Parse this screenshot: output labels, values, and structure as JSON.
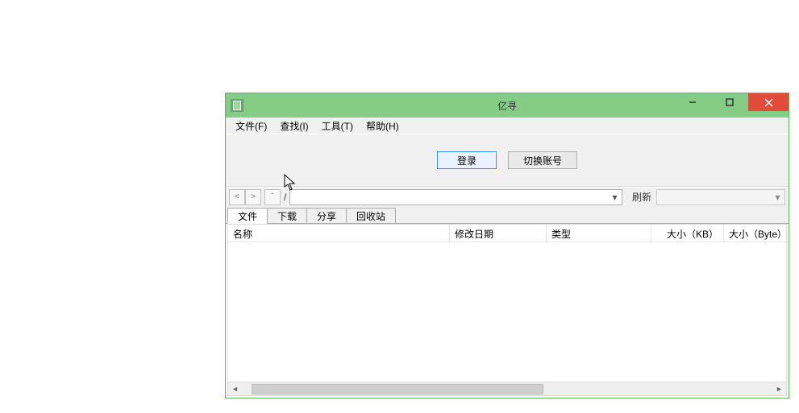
{
  "window": {
    "title": "亿寻"
  },
  "menu": {
    "file": "文件(F)",
    "find": "查找(I)",
    "tools": "工具(T)",
    "help": "帮助(H)"
  },
  "toolbar": {
    "login": "登录",
    "switch_account": "切换账号"
  },
  "nav": {
    "back": "<",
    "forward": ">",
    "up": "ˆ",
    "path_separator": "/",
    "path_value": "",
    "refresh": "刷新",
    "side_value": ""
  },
  "tabs": {
    "files": "文件",
    "downloads": "下载",
    "share": "分享",
    "recycle": "回收站"
  },
  "columns": {
    "name": "名称",
    "modified": "修改日期",
    "type": "类型",
    "size_kb": "大小（KB）",
    "size_byte": "大小（Byte）"
  },
  "rows": []
}
